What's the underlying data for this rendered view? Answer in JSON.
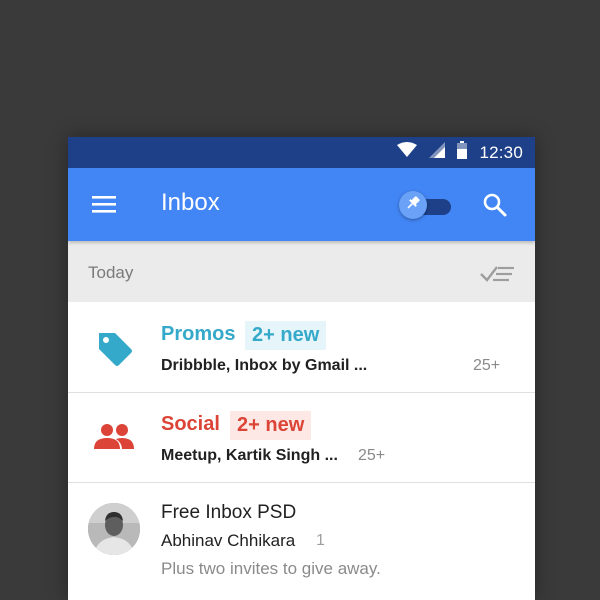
{
  "status_bar": {
    "time": "12:30",
    "icons": [
      "wifi-icon",
      "signal-icon",
      "battery-icon"
    ]
  },
  "app_bar": {
    "title": "Inbox",
    "menu_icon": "menu-icon",
    "pin_toggle_icon": "pin-icon",
    "pin_toggle_on": false,
    "search_icon": "search-icon"
  },
  "section": {
    "title": "Today",
    "sweep_icon": "sweep-done-icon"
  },
  "bundles": [
    {
      "icon": "tag-icon",
      "title": "Promos",
      "badge": "2+ new",
      "snippet": "Dribbble, Inbox by Gmail ...",
      "count": "25+",
      "color": "#35a9c9",
      "badge_bg": "#e5f5fa"
    },
    {
      "icon": "people-icon",
      "title": "Social",
      "badge": "2+ new",
      "snippet": "Meetup, Kartik Singh ...",
      "count": "25+",
      "color": "#db4437",
      "badge_bg": "#fde8e6"
    }
  ],
  "email": {
    "subject": "Free Inbox PSD",
    "sender": "Abhinav Chhikara",
    "sender_count": "1",
    "snippet": "Plus two invites to give away."
  },
  "colors": {
    "background": "#3a3a3a",
    "status_bar": "#1d4088",
    "app_bar": "#4285f4",
    "section_bg": "#ebebeb"
  }
}
